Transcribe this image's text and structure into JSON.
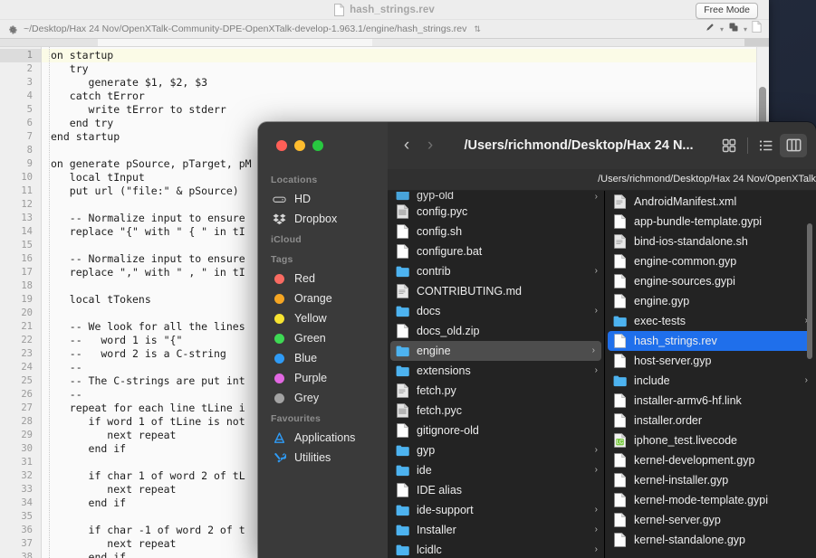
{
  "editor": {
    "title": "hash_strings.rev",
    "title_icon": "document-icon",
    "free_mode_label": "Free Mode",
    "gear_icon": "gear-icon",
    "path": "~/Desktop/Hax 24 Nov/OpenXTalk-Community-DPE-OpenXTalk-develop-1.963.1/engine/hash_strings.rev",
    "path_stepper": "⌃⌄",
    "toolbar_icons": [
      "pin-icon",
      "chevron-down-icon",
      "copy-icon",
      "chevron-down-icon",
      "new-document-icon"
    ],
    "active_line": 1,
    "lines": [
      {
        "n": 1,
        "text": "on startup"
      },
      {
        "n": 2,
        "text": "   try"
      },
      {
        "n": 3,
        "text": "      generate $1, $2, $3"
      },
      {
        "n": 4,
        "text": "   catch tError"
      },
      {
        "n": 5,
        "text": "      write tError to stderr"
      },
      {
        "n": 6,
        "text": "   end try"
      },
      {
        "n": 7,
        "text": "end startup"
      },
      {
        "n": 8,
        "text": ""
      },
      {
        "n": 9,
        "text": "on generate pSource, pTarget, pM"
      },
      {
        "n": 10,
        "text": "   local tInput"
      },
      {
        "n": 11,
        "text": "   put url (\"file:\" & pSource)"
      },
      {
        "n": 12,
        "text": ""
      },
      {
        "n": 13,
        "text": "   -- Normalize input to ensure"
      },
      {
        "n": 14,
        "text": "   replace \"{\" with \" { \" in tI"
      },
      {
        "n": 15,
        "text": ""
      },
      {
        "n": 16,
        "text": "   -- Normalize input to ensure"
      },
      {
        "n": 17,
        "text": "   replace \",\" with \" , \" in tI"
      },
      {
        "n": 18,
        "text": ""
      },
      {
        "n": 19,
        "text": "   local tTokens"
      },
      {
        "n": 20,
        "text": ""
      },
      {
        "n": 21,
        "text": "   -- We look for all the lines"
      },
      {
        "n": 22,
        "text": "   --   word 1 is \"{\""
      },
      {
        "n": 23,
        "text": "   --   word 2 is a C-string"
      },
      {
        "n": 24,
        "text": "   --"
      },
      {
        "n": 25,
        "text": "   -- The C-strings are put int"
      },
      {
        "n": 26,
        "text": "   --"
      },
      {
        "n": 27,
        "text": "   repeat for each line tLine i"
      },
      {
        "n": 28,
        "text": "      if word 1 of tLine is not"
      },
      {
        "n": 29,
        "text": "         next repeat"
      },
      {
        "n": 30,
        "text": "      end if"
      },
      {
        "n": 31,
        "text": ""
      },
      {
        "n": 32,
        "text": "      if char 1 of word 2 of tL"
      },
      {
        "n": 33,
        "text": "         next repeat"
      },
      {
        "n": 34,
        "text": "      end if"
      },
      {
        "n": 35,
        "text": ""
      },
      {
        "n": 36,
        "text": "      if char -1 of word 2 of t"
      },
      {
        "n": 37,
        "text": "         next repeat"
      },
      {
        "n": 38,
        "text": "      end if"
      }
    ]
  },
  "finder": {
    "window_controls": [
      "close-button",
      "minimize-button",
      "maximize-button"
    ],
    "back_label": "‹",
    "forward_label": "›",
    "path_title": "/Users/richmond/Desktop/Hax 24 N...",
    "subpath": "/Users/richmond/Desktop/Hax 24 Nov/OpenXTalk",
    "view_buttons": [
      {
        "name": "icon-view-button",
        "active": false
      },
      {
        "name": "list-view-button",
        "active": false
      },
      {
        "name": "column-view-button",
        "active": true
      }
    ],
    "sidebar": {
      "groups": [
        {
          "label": "Locations",
          "items": [
            {
              "label": "HD",
              "icon": "harddisk-icon",
              "type": "icon"
            },
            {
              "label": "Dropbox",
              "icon": "dropbox-icon",
              "type": "icon"
            }
          ]
        },
        {
          "label": "iCloud",
          "items": []
        },
        {
          "label": "Tags",
          "items": [
            {
              "label": "Red",
              "icon": "tag-dot-icon",
              "type": "dot",
              "color": "#f96b62"
            },
            {
              "label": "Orange",
              "icon": "tag-dot-icon",
              "type": "dot",
              "color": "#f5a623"
            },
            {
              "label": "Yellow",
              "icon": "tag-dot-icon",
              "type": "dot",
              "color": "#f7e331"
            },
            {
              "label": "Green",
              "icon": "tag-dot-icon",
              "type": "dot",
              "color": "#3ed954"
            },
            {
              "label": "Blue",
              "icon": "tag-dot-icon",
              "type": "dot",
              "color": "#2f9bf5"
            },
            {
              "label": "Purple",
              "icon": "tag-dot-icon",
              "type": "dot",
              "color": "#e268e2"
            },
            {
              "label": "Grey",
              "icon": "tag-dot-icon",
              "type": "dot",
              "color": "#a3a3a3"
            }
          ]
        },
        {
          "label": "Favourites",
          "items": [
            {
              "label": "Applications",
              "icon": "applications-icon",
              "type": "icon"
            },
            {
              "label": "Utilities",
              "icon": "utilities-icon",
              "type": "icon"
            }
          ]
        }
      ]
    },
    "column_1": [
      {
        "label": "gyp-old",
        "kind": "folder",
        "arrow": true,
        "clipped": true
      },
      {
        "label": "config.pyc",
        "kind": "file-binary",
        "arrow": false
      },
      {
        "label": "config.sh",
        "kind": "file",
        "arrow": false
      },
      {
        "label": "configure.bat",
        "kind": "file",
        "arrow": false
      },
      {
        "label": "contrib",
        "kind": "folder",
        "arrow": true
      },
      {
        "label": "CONTRIBUTING.md",
        "kind": "file-text",
        "arrow": false
      },
      {
        "label": "docs",
        "kind": "folder",
        "arrow": true
      },
      {
        "label": "docs_old.zip",
        "kind": "file",
        "arrow": false
      },
      {
        "label": "engine",
        "kind": "folder",
        "arrow": true,
        "selected": "gray"
      },
      {
        "label": "extensions",
        "kind": "folder",
        "arrow": true
      },
      {
        "label": "fetch.py",
        "kind": "file-text",
        "arrow": false
      },
      {
        "label": "fetch.pyc",
        "kind": "file-binary",
        "arrow": false
      },
      {
        "label": "gitignore-old",
        "kind": "file",
        "arrow": false
      },
      {
        "label": "gyp",
        "kind": "folder",
        "arrow": true
      },
      {
        "label": "ide",
        "kind": "folder",
        "arrow": true
      },
      {
        "label": "IDE alias",
        "kind": "file",
        "arrow": false
      },
      {
        "label": "ide-support",
        "kind": "folder",
        "arrow": true
      },
      {
        "label": "Installer",
        "kind": "folder",
        "arrow": true
      },
      {
        "label": "lcidlc",
        "kind": "folder",
        "arrow": true
      }
    ],
    "column_2": [
      {
        "label": "AndroidManifest.xml",
        "kind": "file-text",
        "arrow": false
      },
      {
        "label": "app-bundle-template.gypi",
        "kind": "file",
        "arrow": false
      },
      {
        "label": "bind-ios-standalone.sh",
        "kind": "file-text",
        "arrow": false
      },
      {
        "label": "engine-common.gyp",
        "kind": "file",
        "arrow": false
      },
      {
        "label": "engine-sources.gypi",
        "kind": "file",
        "arrow": false
      },
      {
        "label": "engine.gyp",
        "kind": "file",
        "arrow": false
      },
      {
        "label": "exec-tests",
        "kind": "folder",
        "arrow": true
      },
      {
        "label": "hash_strings.rev",
        "kind": "file",
        "arrow": false,
        "selected": "blue"
      },
      {
        "label": "host-server.gyp",
        "kind": "file",
        "arrow": false
      },
      {
        "label": "include",
        "kind": "folder",
        "arrow": true
      },
      {
        "label": "installer-armv6-hf.link",
        "kind": "file",
        "arrow": false
      },
      {
        "label": "installer.order",
        "kind": "file",
        "arrow": false
      },
      {
        "label": "iphone_test.livecode",
        "kind": "file-livecode",
        "arrow": false
      },
      {
        "label": "kernel-development.gyp",
        "kind": "file",
        "arrow": false
      },
      {
        "label": "kernel-installer.gyp",
        "kind": "file",
        "arrow": false
      },
      {
        "label": "kernel-mode-template.gypi",
        "kind": "file",
        "arrow": false
      },
      {
        "label": "kernel-server.gyp",
        "kind": "file",
        "arrow": false
      },
      {
        "label": "kernel-standalone.gyp",
        "kind": "file",
        "arrow": false
      }
    ]
  },
  "colors": {
    "selection_blue": "#1f6feb",
    "selection_gray": "#4d4d4d",
    "folder_blue": "#4db3f0",
    "sidebar_bg": "#3a3a3a",
    "column_bg": "#232323"
  }
}
